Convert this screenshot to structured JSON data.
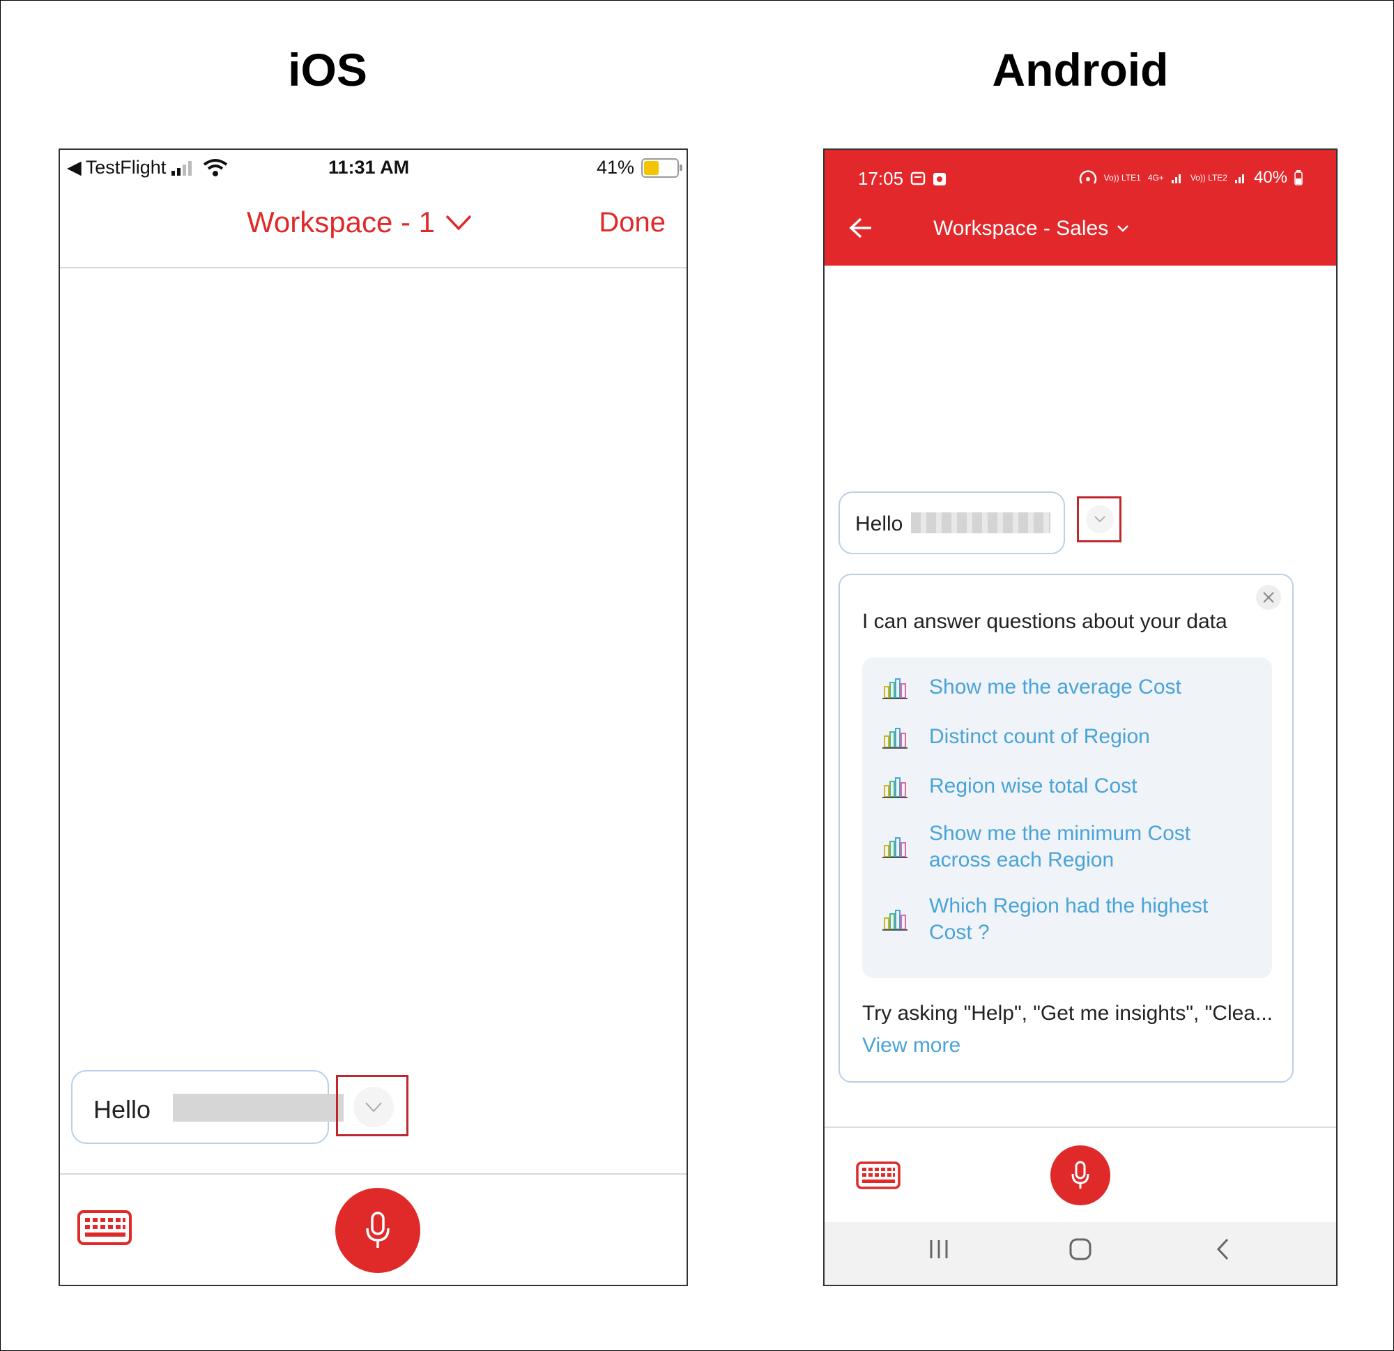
{
  "labels": {
    "ios": "iOS",
    "android": "Android"
  },
  "ios": {
    "status": {
      "carrier_back": "TestFlight",
      "time": "11:31 AM",
      "battery": "41%",
      "battery_level": 0.41
    },
    "nav": {
      "title": "Workspace - 1",
      "done": "Done"
    },
    "greeting": "Hello"
  },
  "android": {
    "status": {
      "time": "17:05",
      "battery": "40%",
      "network_a": "Vo)) LTE1",
      "network_b": "4G+",
      "network_c": "Vo)) LTE2"
    },
    "nav": {
      "title": "Workspace - Sales"
    },
    "greeting": "Hello",
    "card": {
      "title": "I can answer questions about your data",
      "suggestions": [
        "Show me the average Cost",
        "Distinct count of Region",
        "Region wise total Cost",
        "Show me the minimum Cost across each Region",
        "Which Region had the highest Cost ?"
      ],
      "try": "Try asking \"Help\", \"Get me insights\", \"Clea...",
      "view_more": "View more"
    }
  },
  "colors": {
    "accent": "#e02a2a",
    "link": "#4aa3d8",
    "highlight_box": "#c0272d"
  }
}
